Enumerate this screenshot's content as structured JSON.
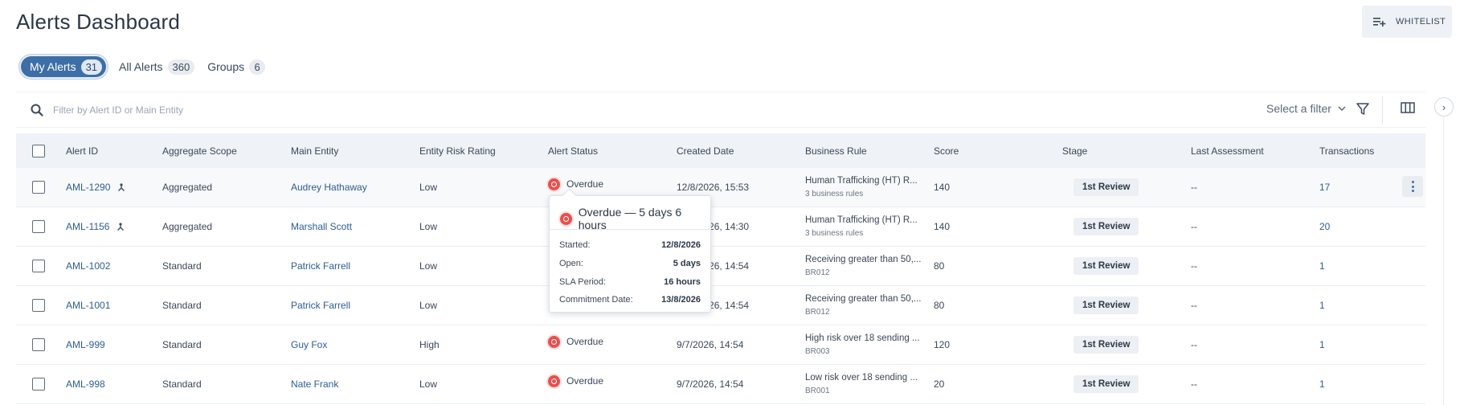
{
  "header": {
    "title": "Alerts Dashboard",
    "whitelist_label": "WHITELIST"
  },
  "tabs": [
    {
      "label": "My Alerts",
      "count": "31",
      "active": true
    },
    {
      "label": "All Alerts",
      "count": "360",
      "active": false
    },
    {
      "label": "Groups",
      "count": "6",
      "active": false
    }
  ],
  "toolbar": {
    "search_placeholder": "Filter by Alert ID or Main Entity",
    "filter_label": "Select a filter"
  },
  "table": {
    "columns": [
      "Alert ID",
      "Aggregate Scope",
      "Main Entity",
      "Entity Risk Rating",
      "Alert Status",
      "Created Date",
      "Business Rule",
      "Score",
      "Stage",
      "Last Assessment",
      "Transactions"
    ],
    "rows": [
      {
        "id": "AML-1290",
        "aggregated": true,
        "scope": "Aggregated",
        "entity": "Audrey Hathaway",
        "risk": "Low",
        "status": "Overdue",
        "created": "12/8/2026, 15:53",
        "rule": "Human Trafficking (HT) R...",
        "rule_sub": "3 business rules",
        "score": "140",
        "stage": "1st Review",
        "last": "--",
        "tx": "17"
      },
      {
        "id": "AML-1156",
        "aggregated": true,
        "scope": "Aggregated",
        "entity": "Marshall Scott",
        "risk": "Low",
        "status": "",
        "created": "12/8/2026, 14:30",
        "rule": "Human Trafficking (HT) R...",
        "rule_sub": "3 business rules",
        "score": "140",
        "stage": "1st Review",
        "last": "--",
        "tx": "20"
      },
      {
        "id": "AML-1002",
        "aggregated": false,
        "scope": "Standard",
        "entity": "Patrick Farrell",
        "risk": "Low",
        "status": "",
        "created": "12/8/2026, 14:54",
        "rule": "Receiving greater than 50,...",
        "rule_sub": "BR012",
        "score": "80",
        "stage": "1st Review",
        "last": "--",
        "tx": "1"
      },
      {
        "id": "AML-1001",
        "aggregated": false,
        "scope": "Standard",
        "entity": "Patrick Farrell",
        "risk": "Low",
        "status": "",
        "created": "12/8/2026, 14:54",
        "rule": "Receiving greater than 50,...",
        "rule_sub": "BR012",
        "score": "80",
        "stage": "1st Review",
        "last": "--",
        "tx": "1"
      },
      {
        "id": "AML-999",
        "aggregated": false,
        "scope": "Standard",
        "entity": "Guy Fox",
        "risk": "High",
        "status": "Overdue",
        "created": "9/7/2026, 14:54",
        "rule": "High risk over 18 sending ...",
        "rule_sub": "BR003",
        "score": "120",
        "stage": "1st Review",
        "last": "--",
        "tx": "1"
      },
      {
        "id": "AML-998",
        "aggregated": false,
        "scope": "Standard",
        "entity": "Nate Frank",
        "risk": "Low",
        "status": "Overdue",
        "created": "9/7/2026, 14:54",
        "rule": "Low risk over 18 sending ...",
        "rule_sub": "BR001",
        "score": "20",
        "stage": "1st Review",
        "last": "--",
        "tx": "1"
      }
    ]
  },
  "tooltip": {
    "title": "Overdue — 5 days 6 hours",
    "rows": [
      {
        "label": "Started:",
        "value": "12/8/2026"
      },
      {
        "label": "Open:",
        "value": "5 days"
      },
      {
        "label": "SLA Period:",
        "value": "16 hours"
      },
      {
        "label": "Commitment Date:",
        "value": "13/8/2026"
      }
    ]
  },
  "colors": {
    "primary": "#3d6ea6",
    "link": "#2c5d94",
    "overdue": "#e8504e",
    "header_bg": "#eff2f6"
  }
}
